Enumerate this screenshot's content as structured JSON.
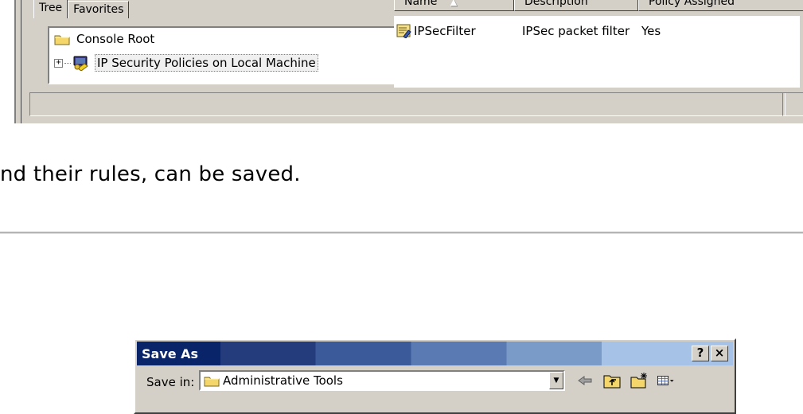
{
  "console": {
    "tabs": [
      {
        "label": "Tree",
        "active": true
      },
      {
        "label": "Favorites",
        "active": false
      }
    ],
    "tree": {
      "items": [
        {
          "label": "Console Root",
          "icon": "folder-icon"
        },
        {
          "label": "IP Security Policies on Local Machine",
          "icon": "ip-security-icon",
          "expander": "+"
        }
      ]
    },
    "list": {
      "columns": {
        "name": "Name",
        "description": "Description",
        "policy": "Policy Assigned"
      },
      "sort_indicator": "▲",
      "rows": [
        {
          "name": "IPSecFilter",
          "description": "IPSec packet filter",
          "policy": "Yes",
          "icon": "policy-icon"
        }
      ]
    }
  },
  "document": {
    "text": "nd their rules, can be saved."
  },
  "dialog": {
    "title": "Save As",
    "help_label": "?",
    "close_label": "×",
    "save_in_label": "Save in:",
    "save_in_value": "Administrative Tools",
    "toolbar_icons": [
      "back-icon",
      "up-folder-icon",
      "new-folder-icon",
      "view-menu-icon"
    ]
  },
  "colors": {
    "window_face": "#d4d0c8",
    "titlebar_dark": "#0a246a",
    "titlebar_light": "#a6c2e6"
  }
}
